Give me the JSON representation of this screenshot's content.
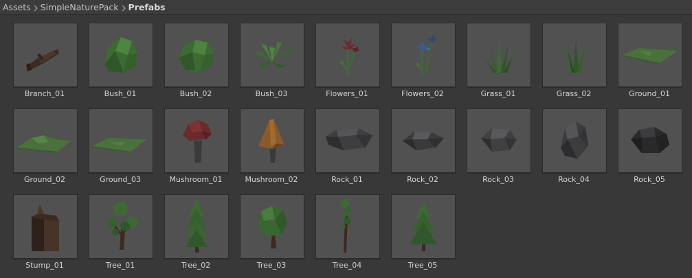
{
  "breadcrumb": {
    "items": [
      "Assets",
      "SimpleNaturePack",
      "Prefabs"
    ]
  },
  "assets": [
    {
      "name": "Branch_01",
      "icon": "branch-icon"
    },
    {
      "name": "Bush_01",
      "icon": "bush-icon"
    },
    {
      "name": "Bush_02",
      "icon": "bush-icon"
    },
    {
      "name": "Bush_03",
      "icon": "leafy-bush-icon"
    },
    {
      "name": "Flowers_01",
      "icon": "red-flower-icon"
    },
    {
      "name": "Flowers_02",
      "icon": "blue-flower-icon"
    },
    {
      "name": "Grass_01",
      "icon": "grass-icon"
    },
    {
      "name": "Grass_02",
      "icon": "grass-icon"
    },
    {
      "name": "Ground_01",
      "icon": "ground-tile-icon"
    },
    {
      "name": "Ground_02",
      "icon": "ground-mound-icon"
    },
    {
      "name": "Ground_03",
      "icon": "ground-tile-icon"
    },
    {
      "name": "Mushroom_01",
      "icon": "red-mushroom-icon"
    },
    {
      "name": "Mushroom_02",
      "icon": "brown-mushroom-icon"
    },
    {
      "name": "Rock_01",
      "icon": "flat-rock-icon"
    },
    {
      "name": "Rock_02",
      "icon": "flat-rock-icon"
    },
    {
      "name": "Rock_03",
      "icon": "rock-icon"
    },
    {
      "name": "Rock_04",
      "icon": "tall-rock-icon"
    },
    {
      "name": "Rock_05",
      "icon": "dark-rock-icon"
    },
    {
      "name": "Stump_01",
      "icon": "stump-icon"
    },
    {
      "name": "Tree_01",
      "icon": "branched-tree-icon"
    },
    {
      "name": "Tree_02",
      "icon": "pine-tree-icon"
    },
    {
      "name": "Tree_03",
      "icon": "round-tree-icon"
    },
    {
      "name": "Tree_04",
      "icon": "tall-thin-tree-icon"
    },
    {
      "name": "Tree_05",
      "icon": "pine-tree-icon"
    }
  ],
  "colors": {
    "background": "#383838",
    "thumbnail": "#515151",
    "foliage": "#3f6a34",
    "rock": "#3c3c3e",
    "wood": "#3a2a22"
  }
}
